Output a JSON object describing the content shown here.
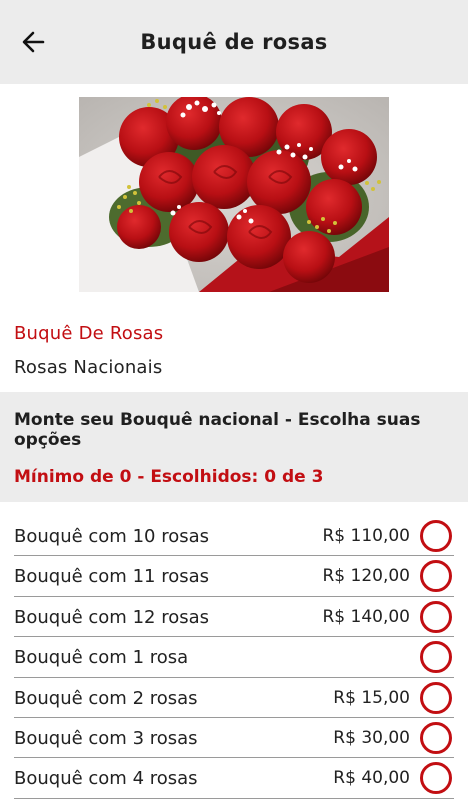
{
  "header": {
    "title": "Buquê de rosas",
    "back_icon": "arrow-left-icon"
  },
  "product": {
    "name": "Buquê De Rosas",
    "subtitle": "Rosas Nacionais"
  },
  "options_section": {
    "title": "Monte seu Bouquê nacional - Escolha suas opções",
    "hint": "Mínimo de 0 - Escolhidos: 0 de 3"
  },
  "options": [
    {
      "label": "Bouquê com 10 rosas",
      "price": "R$ 110,00"
    },
    {
      "label": "Bouquê com 11 rosas",
      "price": "R$ 120,00"
    },
    {
      "label": "Bouquê com 12 rosas",
      "price": "R$ 140,00"
    },
    {
      "label": "Bouquê com 1 rosa",
      "price": ""
    },
    {
      "label": "Bouquê com 2 rosas",
      "price": "R$ 15,00"
    },
    {
      "label": "Bouquê com 3 rosas",
      "price": "R$ 30,00"
    },
    {
      "label": "Bouquê com 4 rosas",
      "price": "R$ 40,00"
    }
  ],
  "colors": {
    "accent": "#c20e12",
    "header_bg": "#ececec"
  }
}
